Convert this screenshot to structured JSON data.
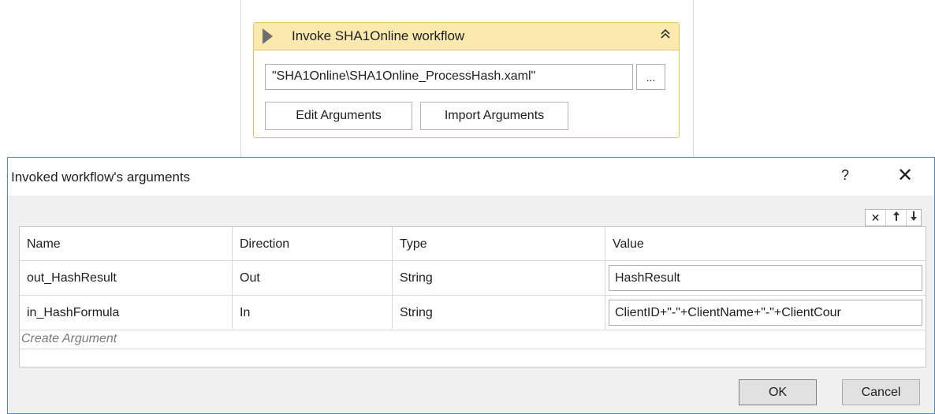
{
  "activity": {
    "title": "Invoke SHA1Online workflow",
    "collapse_icon": "double-chevron-up",
    "workflow_path": "\"SHA1Online\\SHA1Online_ProcessHash.xaml\"",
    "browse_label": "...",
    "edit_arguments_label": "Edit Arguments",
    "import_arguments_label": "Import Arguments"
  },
  "dialog": {
    "title": "Invoked workflow's arguments",
    "help_label": "?",
    "close_label": "✕",
    "toolbar": {
      "delete_icon": "✕",
      "move_up_icon": "🡑",
      "move_down_icon": "🡓"
    },
    "columns": [
      "Name",
      "Direction",
      "Type",
      "Value"
    ],
    "rows": [
      {
        "name": "out_HashResult",
        "direction": "Out",
        "type": "String",
        "value": "HashResult"
      },
      {
        "name": "in_HashFormula",
        "direction": "In",
        "type": "String",
        "value": "ClientID+\"-\"+ClientName+\"-\"+ClientCour"
      }
    ],
    "create_argument_label": "Create Argument",
    "ok_label": "OK",
    "cancel_label": "Cancel"
  },
  "colors": {
    "activity_header": "#fbe9ad",
    "activity_border": "#e7c26a",
    "dialog_border": "#4a8ad8",
    "dialog_background": "#f0f0f0"
  }
}
